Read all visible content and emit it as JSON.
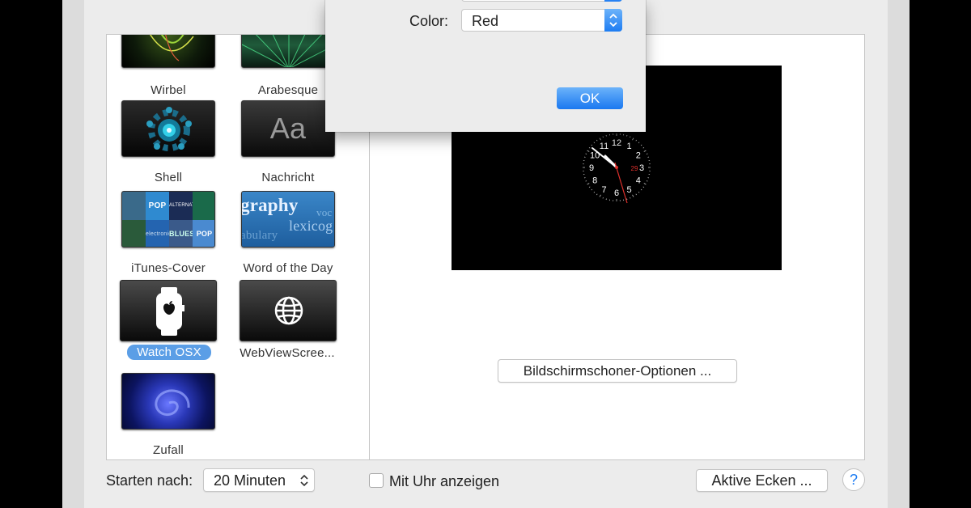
{
  "screensavers": [
    {
      "name": "Wirbel"
    },
    {
      "name": "Arabesque"
    },
    {
      "name": "Shell"
    },
    {
      "name": "Nachricht",
      "thumb_text": "Aa"
    },
    {
      "name": "iTunes-Cover"
    },
    {
      "name": "Word of the Day",
      "thumb_words": [
        "graphy",
        "voc",
        "lexicog",
        "abulary"
      ]
    },
    {
      "name": "Watch OSX",
      "selected": true
    },
    {
      "name": "WebViewScree..."
    },
    {
      "name": "Zufall"
    }
  ],
  "itunes_covers": [
    "POP",
    "ALTERNATIVE",
    "electronic",
    "BLUES",
    "POP"
  ],
  "preview": {
    "clock_numbers": [
      "12",
      "1",
      "2",
      "3",
      "4",
      "5",
      "6",
      "7",
      "8",
      "9",
      "10",
      "11"
    ],
    "date": "29"
  },
  "options_button": "Bildschirmschoner-Optionen ...",
  "dialog": {
    "color_label": "Color:",
    "color_value": "Red",
    "ok_label": "OK"
  },
  "bottom": {
    "start_label": "Starten nach:",
    "start_value": "20 Minuten",
    "clock_checkbox_label": "Mit Uhr anzeigen",
    "clock_checked": false,
    "hot_corners_label": "Aktive Ecken ...",
    "help_label": "?"
  },
  "colors": {
    "accent": "#1d7cf2",
    "selection": "#5b9ee6",
    "clock_red": "#e0302c"
  }
}
